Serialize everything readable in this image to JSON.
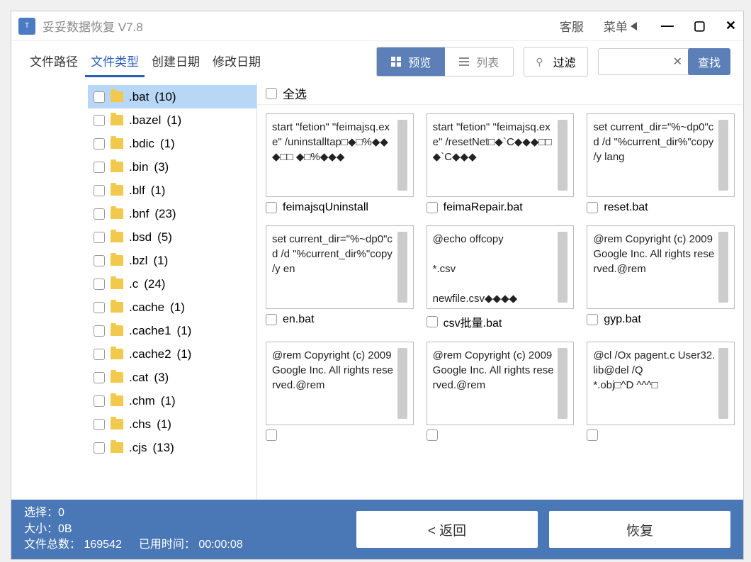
{
  "titlebar": {
    "app_name": "妥妥数据恢复  V7.8",
    "customer_service": "客服",
    "menu": "菜单"
  },
  "tabs": {
    "path": "文件路径",
    "type": "文件类型",
    "created": "创建日期",
    "modified": "修改日期"
  },
  "toolbar": {
    "preview": "预览",
    "list": "列表",
    "filter": "过滤",
    "search": "查找"
  },
  "select_all": "全选",
  "tree": [
    {
      "ext": ".bat",
      "count": "(10)",
      "selected": true
    },
    {
      "ext": ".bazel",
      "count": "(1)"
    },
    {
      "ext": ".bdic",
      "count": "(1)"
    },
    {
      "ext": ".bin",
      "count": "(3)"
    },
    {
      "ext": ".blf",
      "count": "(1)"
    },
    {
      "ext": ".bnf",
      "count": "(23)"
    },
    {
      "ext": ".bsd",
      "count": "(5)"
    },
    {
      "ext": ".bzl",
      "count": "(1)"
    },
    {
      "ext": ".c",
      "count": "(24)"
    },
    {
      "ext": ".cache",
      "count": "(1)"
    },
    {
      "ext": ".cache1",
      "count": "(1)"
    },
    {
      "ext": ".cache2",
      "count": "(1)"
    },
    {
      "ext": ".cat",
      "count": "(3)"
    },
    {
      "ext": ".chm",
      "count": "(1)"
    },
    {
      "ext": ".chs",
      "count": "(1)"
    },
    {
      "ext": ".cjs",
      "count": "(13)"
    }
  ],
  "files": [
    {
      "name": "feimajsqUninstall",
      "preview": "start \"fetion\" \"feimajsq.exe\" /uninstalltap□◆□%◆◆◆□□ ◆□%◆◆◆"
    },
    {
      "name": "feimaRepair.bat",
      "preview": "start \"fetion\" \"feimajsq.exe\" /resetNet□◆`C◆◆◆□□         ◆`C◆◆◆"
    },
    {
      "name": "reset.bat",
      "preview": "set current_dir=\"%~dp0\"cd /d \"%current_dir%\"copy /y lang"
    },
    {
      "name": "en.bat",
      "preview": "set current_dir=\"%~dp0\"cd /d \"%current_dir%\"copy /y en"
    },
    {
      "name": "csv批量.bat",
      "preview": "@echo offcopy\n\n*.csv\n\nnewfile.csv◆◆◆◆"
    },
    {
      "name": "gyp.bat",
      "preview": "@rem Copyright (c) 2009 Google Inc. All rights reserved.@rem"
    },
    {
      "name": "",
      "preview": "@rem Copyright (c) 2009 Google Inc. All rights reserved.@rem"
    },
    {
      "name": "",
      "preview": "@rem Copyright (c) 2009 Google Inc. All rights reserved.@rem"
    },
    {
      "name": "",
      "preview": "@cl /Ox pagent.c User32.lib@del /Q\n*.obj□^D  ^^^□"
    }
  ],
  "status": {
    "select_label": "选择：",
    "select_value": "0",
    "size_label": "大小：",
    "size_value": "0B",
    "total_label": "文件总数：",
    "total_value": "169542",
    "elapsed_label": "已用时间：",
    "elapsed_value": "00:00:08",
    "back": "<  返回",
    "recover": "恢复"
  }
}
